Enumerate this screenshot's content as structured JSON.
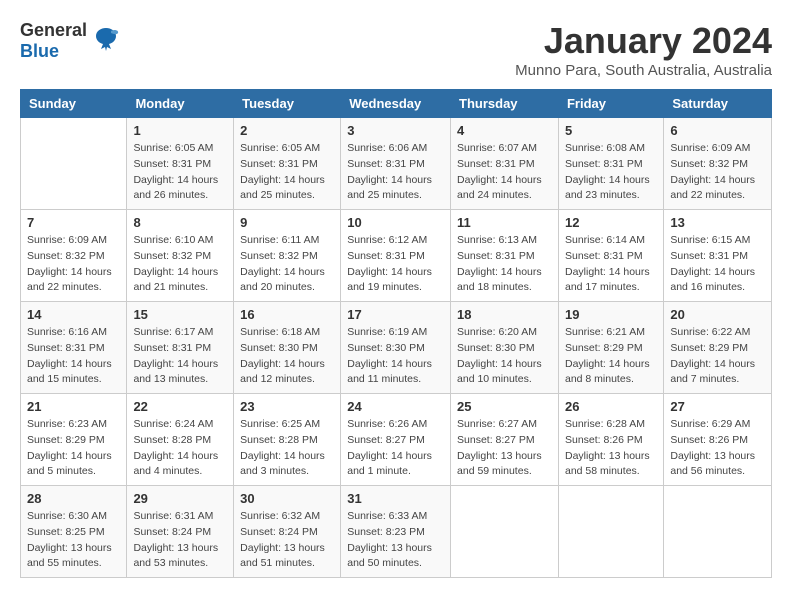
{
  "logo": {
    "general": "General",
    "blue": "Blue"
  },
  "title": "January 2024",
  "subtitle": "Munno Para, South Australia, Australia",
  "weekdays": [
    "Sunday",
    "Monday",
    "Tuesday",
    "Wednesday",
    "Thursday",
    "Friday",
    "Saturday"
  ],
  "weeks": [
    [
      {
        "day": "",
        "info": ""
      },
      {
        "day": "1",
        "info": "Sunrise: 6:05 AM\nSunset: 8:31 PM\nDaylight: 14 hours\nand 26 minutes."
      },
      {
        "day": "2",
        "info": "Sunrise: 6:05 AM\nSunset: 8:31 PM\nDaylight: 14 hours\nand 25 minutes."
      },
      {
        "day": "3",
        "info": "Sunrise: 6:06 AM\nSunset: 8:31 PM\nDaylight: 14 hours\nand 25 minutes."
      },
      {
        "day": "4",
        "info": "Sunrise: 6:07 AM\nSunset: 8:31 PM\nDaylight: 14 hours\nand 24 minutes."
      },
      {
        "day": "5",
        "info": "Sunrise: 6:08 AM\nSunset: 8:31 PM\nDaylight: 14 hours\nand 23 minutes."
      },
      {
        "day": "6",
        "info": "Sunrise: 6:09 AM\nSunset: 8:32 PM\nDaylight: 14 hours\nand 22 minutes."
      }
    ],
    [
      {
        "day": "7",
        "info": "Sunrise: 6:09 AM\nSunset: 8:32 PM\nDaylight: 14 hours\nand 22 minutes."
      },
      {
        "day": "8",
        "info": "Sunrise: 6:10 AM\nSunset: 8:32 PM\nDaylight: 14 hours\nand 21 minutes."
      },
      {
        "day": "9",
        "info": "Sunrise: 6:11 AM\nSunset: 8:32 PM\nDaylight: 14 hours\nand 20 minutes."
      },
      {
        "day": "10",
        "info": "Sunrise: 6:12 AM\nSunset: 8:31 PM\nDaylight: 14 hours\nand 19 minutes."
      },
      {
        "day": "11",
        "info": "Sunrise: 6:13 AM\nSunset: 8:31 PM\nDaylight: 14 hours\nand 18 minutes."
      },
      {
        "day": "12",
        "info": "Sunrise: 6:14 AM\nSunset: 8:31 PM\nDaylight: 14 hours\nand 17 minutes."
      },
      {
        "day": "13",
        "info": "Sunrise: 6:15 AM\nSunset: 8:31 PM\nDaylight: 14 hours\nand 16 minutes."
      }
    ],
    [
      {
        "day": "14",
        "info": "Sunrise: 6:16 AM\nSunset: 8:31 PM\nDaylight: 14 hours\nand 15 minutes."
      },
      {
        "day": "15",
        "info": "Sunrise: 6:17 AM\nSunset: 8:31 PM\nDaylight: 14 hours\nand 13 minutes."
      },
      {
        "day": "16",
        "info": "Sunrise: 6:18 AM\nSunset: 8:30 PM\nDaylight: 14 hours\nand 12 minutes."
      },
      {
        "day": "17",
        "info": "Sunrise: 6:19 AM\nSunset: 8:30 PM\nDaylight: 14 hours\nand 11 minutes."
      },
      {
        "day": "18",
        "info": "Sunrise: 6:20 AM\nSunset: 8:30 PM\nDaylight: 14 hours\nand 10 minutes."
      },
      {
        "day": "19",
        "info": "Sunrise: 6:21 AM\nSunset: 8:29 PM\nDaylight: 14 hours\nand 8 minutes."
      },
      {
        "day": "20",
        "info": "Sunrise: 6:22 AM\nSunset: 8:29 PM\nDaylight: 14 hours\nand 7 minutes."
      }
    ],
    [
      {
        "day": "21",
        "info": "Sunrise: 6:23 AM\nSunset: 8:29 PM\nDaylight: 14 hours\nand 5 minutes."
      },
      {
        "day": "22",
        "info": "Sunrise: 6:24 AM\nSunset: 8:28 PM\nDaylight: 14 hours\nand 4 minutes."
      },
      {
        "day": "23",
        "info": "Sunrise: 6:25 AM\nSunset: 8:28 PM\nDaylight: 14 hours\nand 3 minutes."
      },
      {
        "day": "24",
        "info": "Sunrise: 6:26 AM\nSunset: 8:27 PM\nDaylight: 14 hours\nand 1 minute."
      },
      {
        "day": "25",
        "info": "Sunrise: 6:27 AM\nSunset: 8:27 PM\nDaylight: 13 hours\nand 59 minutes."
      },
      {
        "day": "26",
        "info": "Sunrise: 6:28 AM\nSunset: 8:26 PM\nDaylight: 13 hours\nand 58 minutes."
      },
      {
        "day": "27",
        "info": "Sunrise: 6:29 AM\nSunset: 8:26 PM\nDaylight: 13 hours\nand 56 minutes."
      }
    ],
    [
      {
        "day": "28",
        "info": "Sunrise: 6:30 AM\nSunset: 8:25 PM\nDaylight: 13 hours\nand 55 minutes."
      },
      {
        "day": "29",
        "info": "Sunrise: 6:31 AM\nSunset: 8:24 PM\nDaylight: 13 hours\nand 53 minutes."
      },
      {
        "day": "30",
        "info": "Sunrise: 6:32 AM\nSunset: 8:24 PM\nDaylight: 13 hours\nand 51 minutes."
      },
      {
        "day": "31",
        "info": "Sunrise: 6:33 AM\nSunset: 8:23 PM\nDaylight: 13 hours\nand 50 minutes."
      },
      {
        "day": "",
        "info": ""
      },
      {
        "day": "",
        "info": ""
      },
      {
        "day": "",
        "info": ""
      }
    ]
  ]
}
